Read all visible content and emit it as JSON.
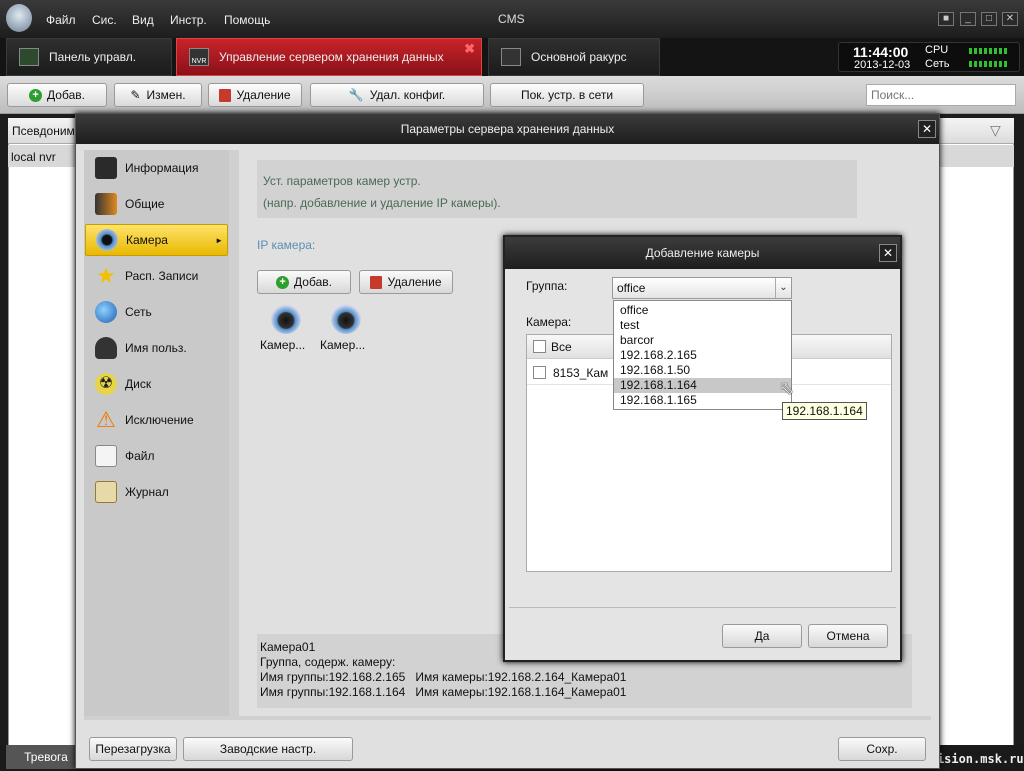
{
  "titlebar": {
    "menu": [
      "Файл",
      "Сис.",
      "Вид",
      "Инстр.",
      "Помощь"
    ],
    "title": "CMS"
  },
  "tabs": [
    {
      "label": "Панель управл."
    },
    {
      "label": "Управление сервером хранения данных",
      "badge": "NVR"
    },
    {
      "label": "Основной ракурс"
    }
  ],
  "clock": {
    "time": "11:44:00",
    "date": "2013-12-03",
    "cpu": "CPU",
    "net": "Сеть"
  },
  "toolbar": {
    "add": "Добав.",
    "edit": "Измен.",
    "delete": "Удаление",
    "remote_config": "Удал. конфиг.",
    "show_online": "Пок. устр. в сети",
    "search_placeholder": "Поиск..."
  },
  "background_list": {
    "header": "Псевдоним",
    "row": "local nvr"
  },
  "bottom": {
    "alarm": "Тревога",
    "watermark": "hikvision.msk.ru"
  },
  "dialog": {
    "title": "Параметры сервера хранения данных",
    "nav": [
      "Информация",
      "Общие",
      "Камера",
      "Расп. Записи",
      "Сеть",
      "Имя польз.",
      "Диск",
      "Исключение",
      "Файл",
      "Журнал"
    ],
    "hint_line1": "Уст. параметров камер устр.",
    "hint_line2": "(напр. добавление и удаление IP камеры).",
    "ip_label": "IP камера:",
    "add": "Добав.",
    "delete": "Удаление",
    "cameras": [
      "Камер...",
      "Камер..."
    ],
    "info": [
      "Камера01",
      "Группа, содерж. камеру:",
      "Имя группы:192.168.2.165   Имя камеры:192.168.2.164_Камера01",
      "Имя группы:192.168.1.164   Имя камеры:192.168.1.164_Камера01"
    ],
    "reboot": "Перезагрузка",
    "factory": "Заводские настр.",
    "save": "Сохр."
  },
  "add_camera": {
    "title": "Добавление камеры",
    "group_label": "Группа:",
    "group_value": "office",
    "camera_label": "Камера:",
    "all": "Все",
    "row": "8153_Кам",
    "options": [
      "office",
      "test",
      "barcor",
      "192.168.2.165",
      "192.168.1.50",
      "192.168.1.164",
      "192.168.1.165"
    ],
    "highlighted": "192.168.1.164",
    "tooltip": "192.168.1.164",
    "ok": "Да",
    "cancel": "Отмена"
  }
}
